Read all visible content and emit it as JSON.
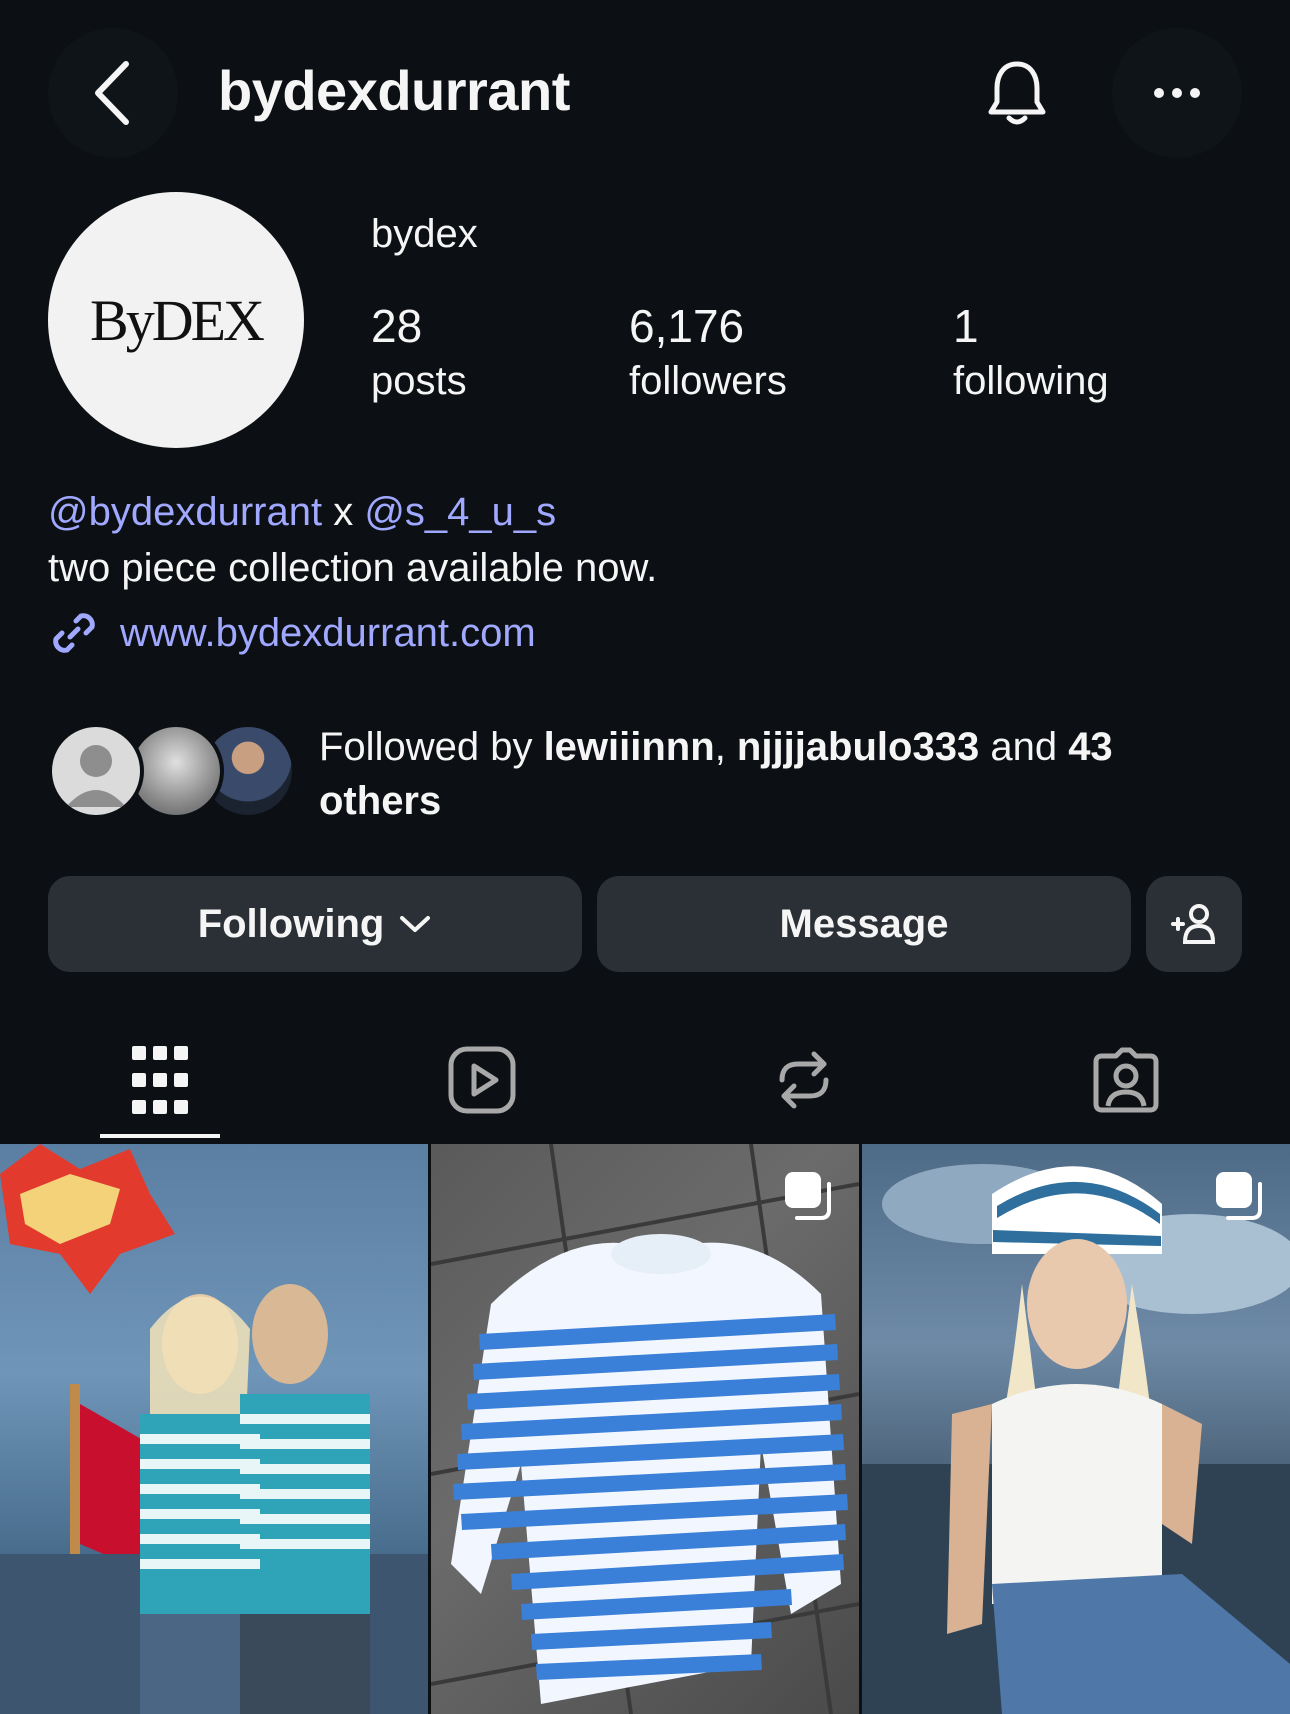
{
  "header": {
    "username": "bydexdurrant",
    "back_icon": "chevron-left-icon",
    "bell_icon": "bell-icon",
    "more_icon": "more-horizontal-icon"
  },
  "profile": {
    "avatar_logo": "ByDEX",
    "display_name": "bydex",
    "stats": {
      "posts_count": "28",
      "posts_label": "posts",
      "followers_count": "6,176",
      "followers_label": "followers",
      "following_count": "1",
      "following_label": "following"
    },
    "bio": {
      "mention1": "@bydexdurrant",
      "connector": " x ",
      "mention2": "@s_4_u_s",
      "line2": "two piece collection available now."
    },
    "link": "www.bydexdurrant.com"
  },
  "followed_by": {
    "prefix": "Followed by ",
    "user1": "lewiiinnn",
    "sep": ", ",
    "user2": "njjjjabulo333",
    "and": " and ",
    "others": "43 others"
  },
  "actions": {
    "following_label": "Following",
    "message_label": "Message"
  },
  "tabs": [
    "grid-icon",
    "reels-icon",
    "reposts-icon",
    "tagged-icon"
  ],
  "colors": {
    "background": "#0c1014",
    "button": "#2a3036",
    "link": "#a0a8ff"
  }
}
